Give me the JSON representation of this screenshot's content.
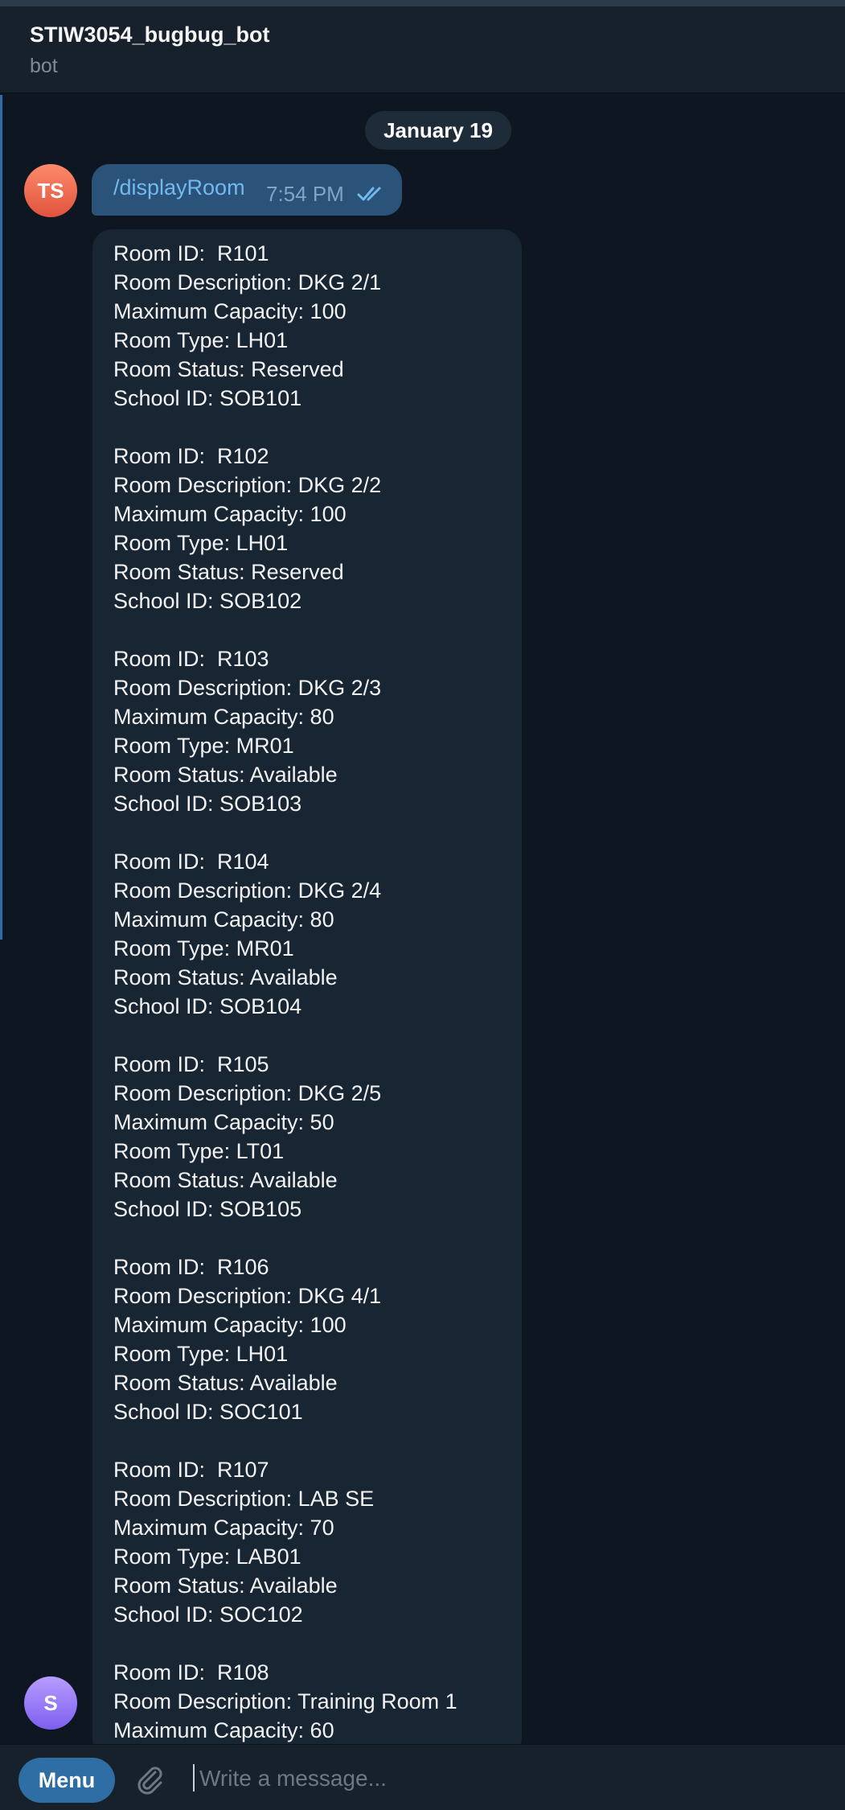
{
  "header": {
    "title": "STIW3054_bugbug_bot",
    "subtitle": "bot"
  },
  "date_separator": "January 19",
  "outgoing": {
    "avatar": "TS",
    "text": "/displayRoom",
    "time": "7:54 PM",
    "status_icon": "double-check-icon"
  },
  "incoming": {
    "avatar": "S",
    "lines": [
      "Room ID:  R101",
      "Room Description: DKG 2/1",
      "Maximum Capacity: 100",
      "Room Type: LH01",
      "Room Status: Reserved",
      "School ID: SOB101",
      "",
      "Room ID:  R102",
      "Room Description: DKG 2/2",
      "Maximum Capacity: 100",
      "Room Type: LH01",
      "Room Status: Reserved",
      "School ID: SOB102",
      "",
      "Room ID:  R103",
      "Room Description: DKG 2/3",
      "Maximum Capacity: 80",
      "Room Type: MR01",
      "Room Status: Available",
      "School ID: SOB103",
      "",
      "Room ID:  R104",
      "Room Description: DKG 2/4",
      "Maximum Capacity: 80",
      "Room Type: MR01",
      "Room Status: Available",
      "School ID: SOB104",
      "",
      "Room ID:  R105",
      "Room Description: DKG 2/5",
      "Maximum Capacity: 50",
      "Room Type: LT01",
      "Room Status: Available",
      "School ID: SOB105",
      "",
      "Room ID:  R106",
      "Room Description: DKG 4/1",
      "Maximum Capacity: 100",
      "Room Type: LH01",
      "Room Status: Available",
      "School ID: SOC101",
      "",
      "Room ID:  R107",
      "Room Description: LAB SE",
      "Maximum Capacity: 70",
      "Room Type: LAB01",
      "Room Status: Available",
      "School ID: SOC102",
      "",
      "Room ID:  R108",
      "Room Description: Training Room 1",
      "Maximum Capacity: 60"
    ]
  },
  "composer": {
    "menu_label": "Menu",
    "placeholder": "Write a message...",
    "attach_icon": "paperclip-icon"
  },
  "colors": {
    "background": "#0e1621",
    "header": "#17212b",
    "outgoing_bubble": "#2b5278",
    "incoming_bubble": "#182533",
    "accent": "#2f6ea5"
  }
}
